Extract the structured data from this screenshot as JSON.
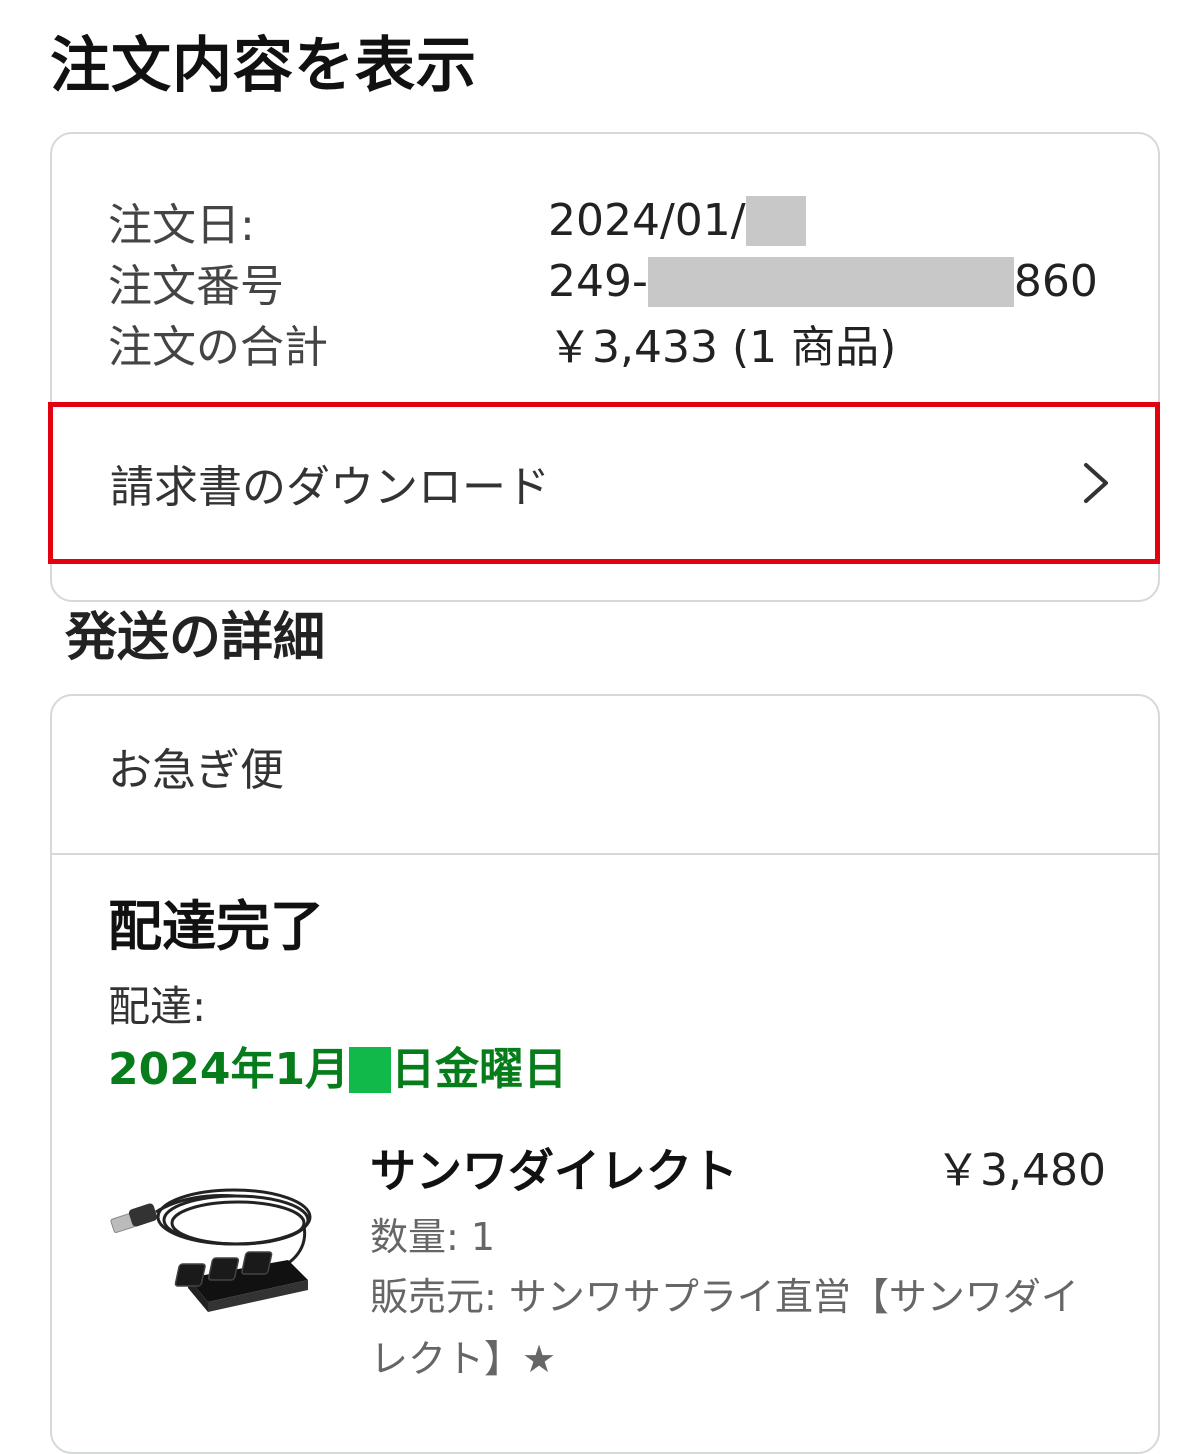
{
  "page": {
    "title": "注文内容を表示"
  },
  "summary": {
    "rows": [
      {
        "label": "注文日:",
        "value_prefix": "2024/01/",
        "value_suffix": ""
      },
      {
        "label": "注文番号",
        "value_prefix": "249-",
        "value_suffix": "860"
      },
      {
        "label": "注文の合計",
        "value_prefix": "￥3,433 (1 商品)",
        "value_suffix": ""
      }
    ],
    "invoice_link": "請求書のダウンロード"
  },
  "shipping": {
    "heading": "発送の詳細",
    "method": "お急ぎ便",
    "status": "配達完了",
    "delivery_label": "配達:",
    "delivery_date_prefix": "2024年1月",
    "delivery_date_suffix": "日金曜日",
    "product": {
      "name": "サンワダイレクト",
      "price": "￥3,480",
      "quantity": "数量: 1",
      "seller": "販売元: サンワサプライ直営【サンワダイレクト】★"
    }
  },
  "colors": {
    "highlight_border": "#e3000f",
    "delivery_green": "#067d1a",
    "redaction_gray": "#c8c8c8"
  },
  "icons": {
    "chevron": "chevron-right-icon"
  }
}
